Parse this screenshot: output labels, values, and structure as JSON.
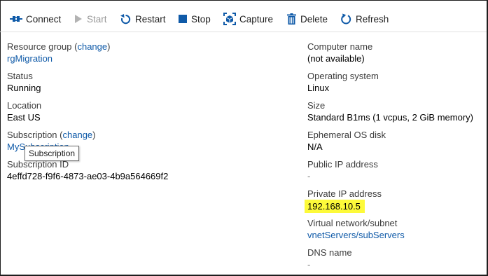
{
  "toolbar": {
    "connect": "Connect",
    "start": "Start",
    "restart": "Restart",
    "stop": "Stop",
    "capture": "Capture",
    "delete": "Delete",
    "refresh": "Refresh"
  },
  "left": {
    "resource_group": {
      "label": "Resource group",
      "open_paren": "(",
      "change": "change",
      "close_paren": ")",
      "value": "rgMigration"
    },
    "status": {
      "label": "Status",
      "value": "Running"
    },
    "location": {
      "label": "Location",
      "value": "East US"
    },
    "subscription": {
      "label": "Subscription",
      "open_paren": "(",
      "change": "change",
      "close_paren": ")",
      "value": "MySubscription"
    },
    "subscription_id": {
      "label": "Subscription ID",
      "value": "4effd728-f9f6-4873-ae03-4b9a564669f2"
    }
  },
  "right": {
    "computer_name": {
      "label": "Computer name",
      "value": "(not available)"
    },
    "os": {
      "label": "Operating system",
      "value": "Linux"
    },
    "size": {
      "label": "Size",
      "value": "Standard B1ms (1 vcpus, 2 GiB memory)"
    },
    "ephemeral": {
      "label": "Ephemeral OS disk",
      "value": "N/A"
    },
    "public_ip": {
      "label": "Public IP address",
      "value": "-"
    },
    "private_ip": {
      "label": "Private IP address",
      "value": "192.168.10.5"
    },
    "vnet": {
      "label": "Virtual network/subnet",
      "value": "vnetServers/subServers"
    },
    "dns": {
      "label": "DNS name",
      "value": "-"
    }
  },
  "tooltip": {
    "text": "Subscription"
  },
  "colors": {
    "link": "#0f5aa8",
    "icon_blue": "#0f5aa8",
    "highlight": "#fdfa3a",
    "disabled": "#9a9a9a"
  }
}
